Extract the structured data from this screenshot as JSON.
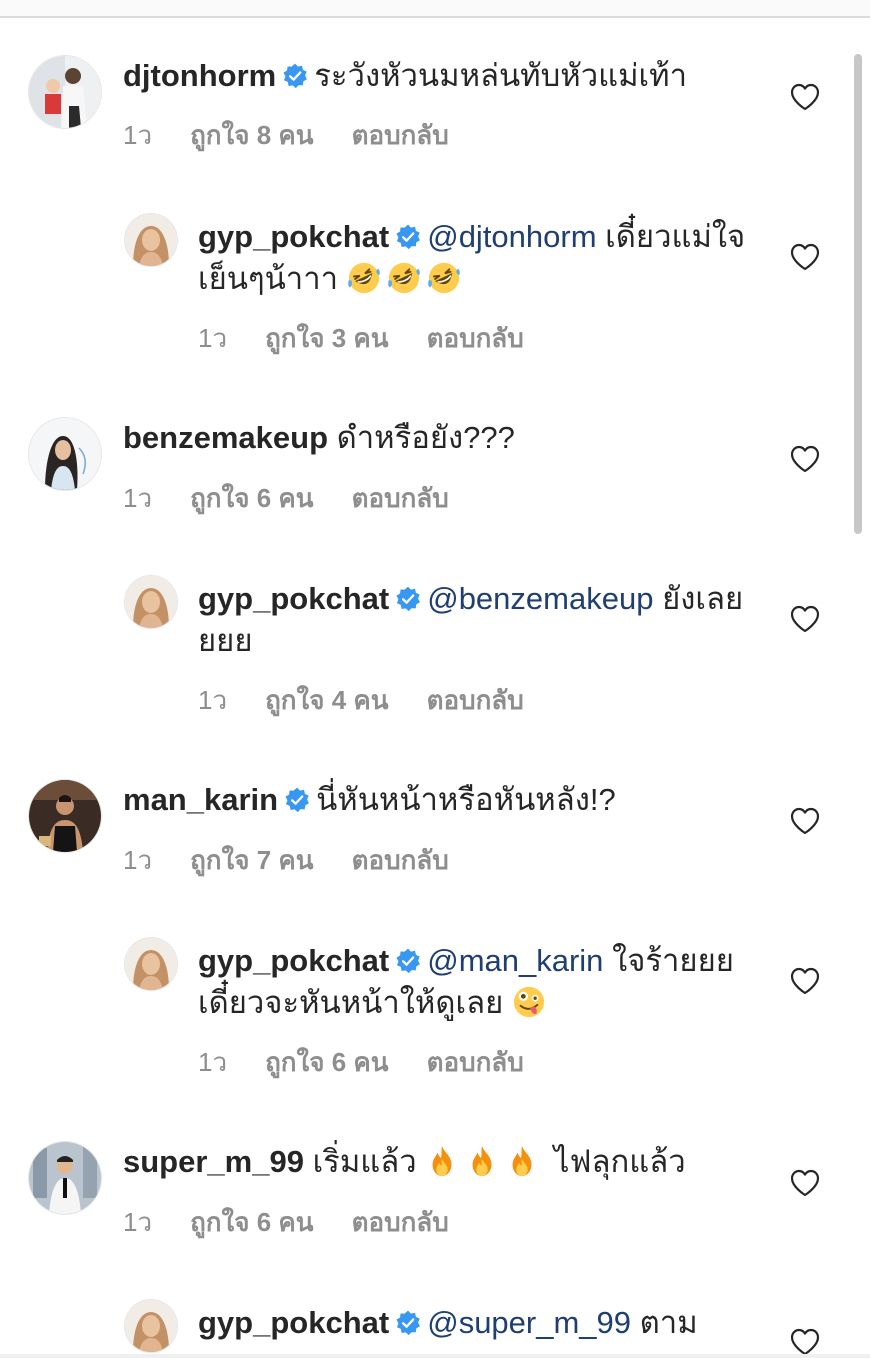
{
  "colors": {
    "verified": "#3897f0",
    "mention": "#1f3f73",
    "meta": "#8e8e8e",
    "text": "#262626"
  },
  "comments": [
    {
      "username": "djtonhorm",
      "verified": true,
      "mention": "",
      "text": "ระวังหัวนมหล่นทับหัวแม่เท้า",
      "time": "1ว",
      "likes": "ถูกใจ 8 คน",
      "reply": "ตอบกลับ",
      "avatar": "avatar-djtonhorm",
      "heart_icon": "heart-outline"
    },
    {
      "username": "gyp_pokchat",
      "verified": true,
      "mention": "@djtonhorm",
      "text": "เดี๋ยวแม่ใจเย็นๆน้าาา",
      "emojis": [
        "rolling-laughing",
        "rolling-laughing",
        "rolling-laughing"
      ],
      "time": "1ว",
      "likes": "ถูกใจ 3 คน",
      "reply": "ตอบกลับ",
      "avatar": "avatar-gyp_pokchat"
    },
    {
      "username": "benzemakeup",
      "verified": false,
      "mention": "",
      "text": "ดำหรือยัง???",
      "time": "1ว",
      "likes": "ถูกใจ 6 คน",
      "reply": "ตอบกลับ",
      "avatar": "avatar-benzemakeup"
    },
    {
      "username": "gyp_pokchat",
      "verified": true,
      "mention": "@benzemakeup",
      "text": "ยังเลยยยย",
      "time": "1ว",
      "likes": "ถูกใจ 4 คน",
      "reply": "ตอบกลับ",
      "avatar": "avatar-gyp_pokchat"
    },
    {
      "username": "man_karin",
      "verified": true,
      "mention": "",
      "text": "นี่หันหน้าหรือหันหลัง!?",
      "time": "1ว",
      "likes": "ถูกใจ 7 คน",
      "reply": "ตอบกลับ",
      "avatar": "avatar-man_karin"
    },
    {
      "username": "gyp_pokchat",
      "verified": true,
      "mention": "@man_karin",
      "text": "ใจร้ายยย เดี๋ยวจะหันหน้าให้ดูเลย",
      "emojis": [
        "zany-face"
      ],
      "time": "1ว",
      "likes": "ถูกใจ 6 คน",
      "reply": "ตอบกลับ",
      "avatar": "avatar-gyp_pokchat"
    },
    {
      "username": "super_m_99",
      "verified": false,
      "mention": "",
      "text_before": "เริ่มแล้ว",
      "emojis": [
        "fire",
        "fire",
        "fire"
      ],
      "text_after": "ไฟลุกแล้ว",
      "time": "1ว",
      "likes": "ถูกใจ 6 คน",
      "reply": "ตอบกลับ",
      "avatar": "avatar-super_m_99"
    },
    {
      "username": "gyp_pokchat",
      "verified": true,
      "mention": "@super_m_99",
      "text": "ตาม",
      "avatar": "avatar-gyp_pokchat"
    }
  ]
}
